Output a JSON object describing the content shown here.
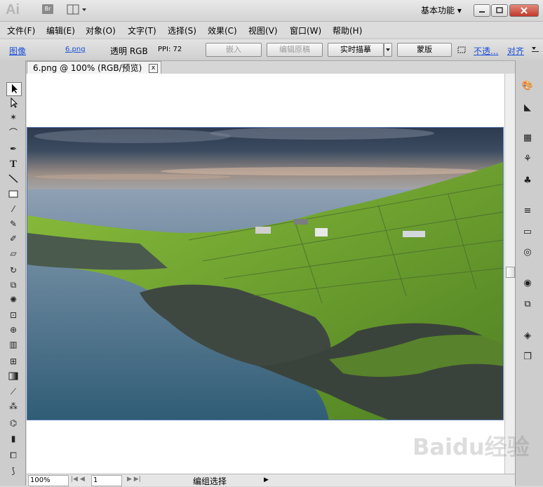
{
  "titlebar": {
    "app_logo": "Ai",
    "bridge_label": "Br",
    "workspace_label": "基本功能 ▾"
  },
  "menu": [
    "文件(F)",
    "编辑(E)",
    "对象(O)",
    "文字(T)",
    "选择(S)",
    "效果(C)",
    "视图(V)",
    "窗口(W)",
    "帮助(H)"
  ],
  "control": {
    "image_label": "图像",
    "filename": "6.png",
    "transparency": "透明 RGB",
    "ppi": "PPI: 72",
    "embed": "嵌入",
    "edit_original": "编辑原稿",
    "live_trace": "实时描摹",
    "mask": "蒙版",
    "opacity_link": "不透...",
    "align_link": "对齐"
  },
  "document": {
    "tab_title": "6.png @ 100% (RGB/预览)",
    "close": "x"
  },
  "status": {
    "zoom": "100%",
    "page": "1",
    "selection": "编组选择"
  },
  "watermark": "Baidu经验"
}
